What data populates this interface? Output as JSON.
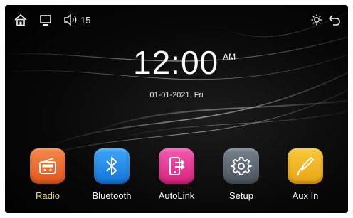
{
  "status_bar": {
    "home_icon": "home-icon",
    "display_icon": "monitor-icon",
    "volume_icon": "speaker-icon",
    "volume_level": "15",
    "brightness_icon": "brightness-icon",
    "back_icon": "back-arrow-icon"
  },
  "clock": {
    "time": "12:00",
    "ampm": "AM",
    "date": "01-01-2021, Fri"
  },
  "apps": [
    {
      "label": "Radio",
      "icon": "radio-icon",
      "color": "#f06a2a",
      "active": true
    },
    {
      "label": "Bluetooth",
      "icon": "bluetooth-icon",
      "color": "#1f8ef0",
      "active": false
    },
    {
      "label": "AutoLink",
      "icon": "autolink-phone-icon",
      "color": "#ec3f9a",
      "active": false
    },
    {
      "label": "Setup",
      "icon": "gear-icon",
      "color": "#5c6670",
      "active": false
    },
    {
      "label": "Aux In",
      "icon": "aux-cable-icon",
      "color": "#f3b623",
      "active": false
    }
  ],
  "colors": {
    "active_label": "#e5e34a",
    "background": "#000000"
  }
}
